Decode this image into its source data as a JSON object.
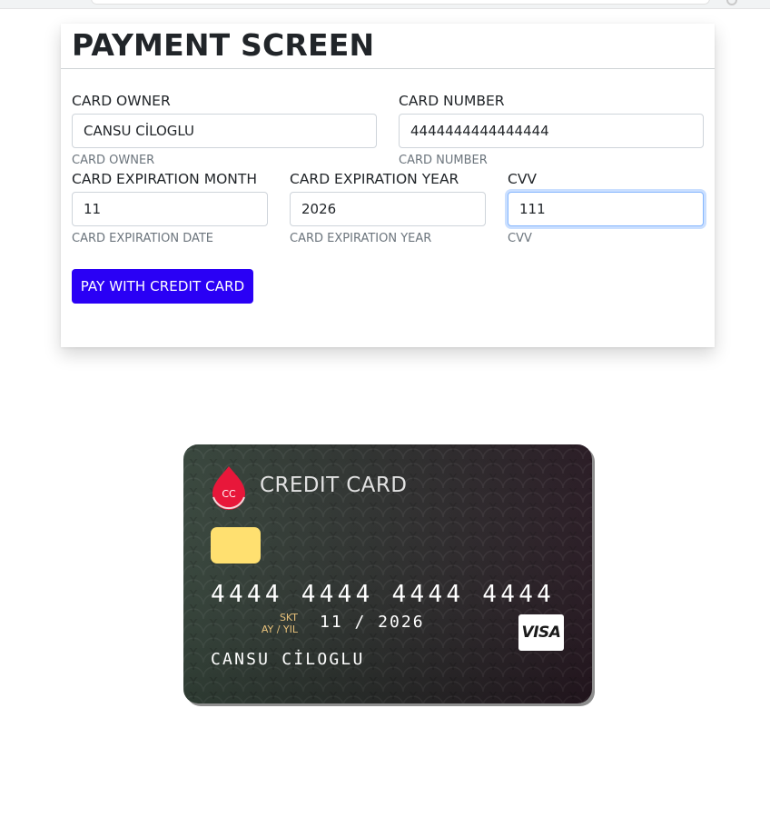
{
  "panel": {
    "title": "PAYMENT SCREEN",
    "button_label": "PAY WITH CREDIT CARD"
  },
  "form": {
    "card_owner": {
      "label": "CARD OWNER",
      "value": "CANSU CİLOGLU",
      "hint": "CARD OWNER"
    },
    "card_number": {
      "label": "CARD NUMBER",
      "value": "4444444444444444",
      "hint": "CARD NUMBER"
    },
    "exp_month": {
      "label": "CARD EXPIRATION MONTH",
      "value": "11",
      "hint": "CARD EXPIRATION DATE"
    },
    "exp_year": {
      "label": "CARD EXPIRATION YEAR",
      "value": "2026",
      "hint": "CARD EXPIRATION YEAR"
    },
    "cvv": {
      "label": "CVV",
      "value": "111",
      "hint": "CVV"
    }
  },
  "card": {
    "logo_text": "CC",
    "brand_title": "CREDIT CARD",
    "number_display": "4444 4444 4444 4444",
    "expiry_label_line1": "SKT",
    "expiry_label_line2": "AY / YIL",
    "expiry_display": "11 / 2026",
    "holder_display": "CANSU CİLOGLU",
    "network": "VISA",
    "network_icon": "visa-logo-icon",
    "chip_icon": "chip-icon"
  },
  "colors": {
    "button_bg": "#2a00f5",
    "chip": "#ffe070",
    "logo_red": "#e8173a",
    "expiry_label": "#e6c07a",
    "focus_border": "#86b7fe"
  }
}
